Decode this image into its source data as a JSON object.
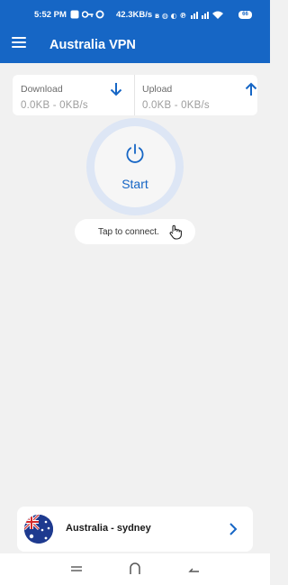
{
  "status_bar": {
    "time": "5:52 PM",
    "speed": "42.3KB/s",
    "battery": "66"
  },
  "app": {
    "title": "Australia VPN"
  },
  "stats": {
    "download_label": "Download",
    "download_value": "0.0KB - 0KB/s",
    "upload_label": "Upload",
    "upload_value": "0.0KB - 0KB/s"
  },
  "power": {
    "label": "Start"
  },
  "hint": {
    "text": "Tap to connect."
  },
  "server": {
    "name": "Australia - sydney"
  },
  "colors": {
    "accent": "#1666c5",
    "background": "#f1f1f1",
    "ring": "#dde6f5"
  },
  "icons": {
    "menu": "menu-icon",
    "download": "arrow-down-icon",
    "upload": "arrow-up-icon",
    "power": "power-icon",
    "hint": "hand-pointer-icon",
    "flag": "australia-flag-icon",
    "chevron": "chevron-right-icon"
  }
}
